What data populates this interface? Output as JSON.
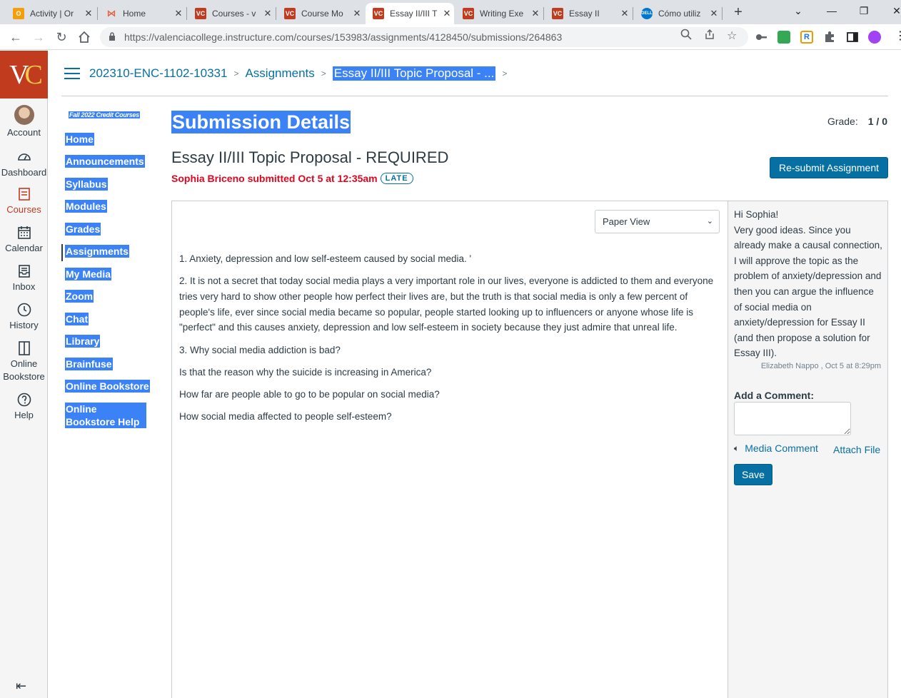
{
  "browser": {
    "tabs": [
      {
        "title": "Activity | Or",
        "icon": "orange-o-icon",
        "color": "#f59e0b",
        "active": false
      },
      {
        "title": "Home",
        "icon": "bird-logo-icon",
        "color": "#e8613c",
        "active": false
      },
      {
        "title": "Courses - v",
        "icon": "vc-icon",
        "color": "#c13b1f",
        "active": false
      },
      {
        "title": "Course Mo",
        "icon": "vc-icon",
        "color": "#c13b1f",
        "active": false
      },
      {
        "title": "Essay II/III T",
        "icon": "vc-icon",
        "color": "#c13b1f",
        "active": true
      },
      {
        "title": "Writing Exe",
        "icon": "vc-icon",
        "color": "#c13b1f",
        "active": false
      },
      {
        "title": "Essay II",
        "icon": "vc-icon",
        "color": "#c13b1f",
        "active": false
      },
      {
        "title": "Cómo utiliz",
        "icon": "dell-icon",
        "color": "#0076ce",
        "active": false
      }
    ],
    "url": "https://valenciacollege.instructure.com/courses/153983/assignments/4128450/submissions/264863"
  },
  "global_nav": {
    "logo": "VC",
    "items": [
      {
        "label": "Account",
        "icon": "avatar"
      },
      {
        "label": "Dashboard",
        "icon": "dashboard-icon"
      },
      {
        "label": "Courses",
        "icon": "courses-icon"
      },
      {
        "label": "Calendar",
        "icon": "calendar-icon"
      },
      {
        "label": "Inbox",
        "icon": "inbox-icon"
      },
      {
        "label": "History",
        "icon": "history-icon"
      },
      {
        "label": "Online Bookstore",
        "icon": "bookstore-icon"
      },
      {
        "label": "Help",
        "icon": "help-icon"
      }
    ]
  },
  "breadcrumb": {
    "course": "202310-ENC-1102-10331",
    "section": "Assignments",
    "current": "Essay II/III Topic Proposal - ..."
  },
  "course_nav": {
    "term": "Fall 2022 Credit Courses",
    "links": [
      "Home",
      "Announcements",
      "Syllabus",
      "Modules",
      "Grades",
      "Assignments",
      "My Media",
      "Zoom",
      "Chat",
      "Library",
      "Brainfuse",
      "Online Bookstore",
      "Online Bookstore Help"
    ]
  },
  "submission": {
    "heading": "Submission Details",
    "grade_label": "Grade:",
    "grade_value": "1 / 0",
    "assignment_title": "Essay II/III Topic Proposal - REQUIRED",
    "submitted_text": "Sophia Briceno submitted Oct 5 at 12:35am",
    "late_badge": "LATE",
    "resubmit_label": "Re-submit Assignment",
    "view_select": "Paper View",
    "paragraphs": [
      "1. Anxiety, depression and low self-esteem caused by social media. '",
      "2. It is not a secret that today social media plays a very important role in our lives, everyone is addicted to them and everyone tries very hard to show other people how perfect their lives are, but the truth is that social media is only a few percent of people's life, ever since social media became so popular, people started looking up to influencers or anyone whose life is \"perfect\" and this causes anxiety, depression and low self-esteem in society because they just admire that unreal life.",
      "3. Why social media addiction is bad?",
      "Is that the reason why the suicide is increasing in America?",
      "How far are people able to go to be popular on social media?",
      "How social media affected to people self-esteem?"
    ]
  },
  "comments": {
    "greeting": "Hi Sophia!",
    "body": "Very good ideas. Since you already make a causal connection, I will approve the topic as the problem of anxiety/depression and then you can argue the influence of social media on anxiety/depression for Essay II  (and then propose a solution for Essay III).",
    "meta": "Elizabeth Nappo , Oct 5 at 8:29pm",
    "add_label": "Add a Comment:",
    "media_label": "Media Comment",
    "attach_label": "Attach File",
    "save_label": "Save"
  },
  "colors": {
    "link": "#0770a3",
    "brand": "#c13b1f",
    "late": "#e0061f",
    "highlight": "#3b82f6"
  }
}
